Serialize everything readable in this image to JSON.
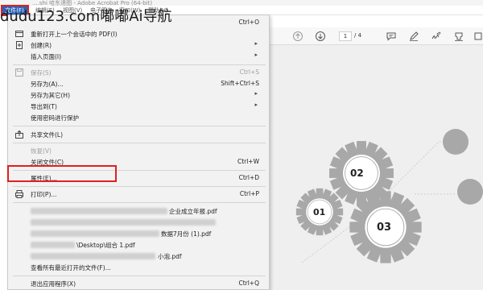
{
  "window": {
    "title": "....shi 哈东達图 - Adobe Acrobat Pro (64-bit)"
  },
  "watermark": "dudu123.com嘟嘟Ai导航",
  "menubar": {
    "file": "文件(F)",
    "edit": "编辑(E)",
    "view": "视图(V)",
    "sign": "电子签名",
    "window": "窗口(W)",
    "help": "帮助(H)"
  },
  "toolbar": {
    "page_current": "1",
    "page_total": "/ 4"
  },
  "file_menu": {
    "items": [
      {
        "label": "",
        "shortcut": "Ctrl+O"
      },
      {
        "label": "重新打开上一个会话中的 PDF(I)",
        "shortcut": ""
      },
      {
        "label": "创建(R)",
        "shortcut": ""
      },
      {
        "label": "插入页面(I)",
        "shortcut": ""
      },
      {
        "label": "保存(S)",
        "shortcut": "Ctrl+S"
      },
      {
        "label": "另存为(A)...",
        "shortcut": "Shift+Ctrl+S"
      },
      {
        "label": "另存为其它(H)",
        "shortcut": ""
      },
      {
        "label": "导出到(T)",
        "shortcut": ""
      },
      {
        "label": "使用密码进行保护",
        "shortcut": ""
      },
      {
        "label": "共享文件(L)",
        "shortcut": ""
      },
      {
        "label": "恢复(V)",
        "shortcut": ""
      },
      {
        "label": "关闭文件(C)",
        "shortcut": "Ctrl+W"
      },
      {
        "label": "属性(E)...",
        "shortcut": "Ctrl+D"
      },
      {
        "label": "打印(P)...",
        "shortcut": "Ctrl+P"
      },
      {
        "label": "企业成立年报.pdf",
        "shortcut": ""
      },
      {
        "label": "数据7月份 (1).pdf",
        "shortcut": ""
      },
      {
        "label": "\\Desktop\\组合 1.pdf",
        "shortcut": ""
      },
      {
        "label": "小泡.pdf",
        "shortcut": ""
      },
      {
        "label": "查看所有最近打开的文件(F)...",
        "shortcut": ""
      },
      {
        "label": "退出应用程序(X)",
        "shortcut": "Ctrl+Q"
      }
    ]
  },
  "document": {
    "gears": [
      "01",
      "02",
      "03"
    ]
  },
  "colors": {
    "menu_bg": "#f2f2f2",
    "highlight": "#e11f1f",
    "file_menu_active": "#2a63b8",
    "gear": "#a8a8a8"
  }
}
